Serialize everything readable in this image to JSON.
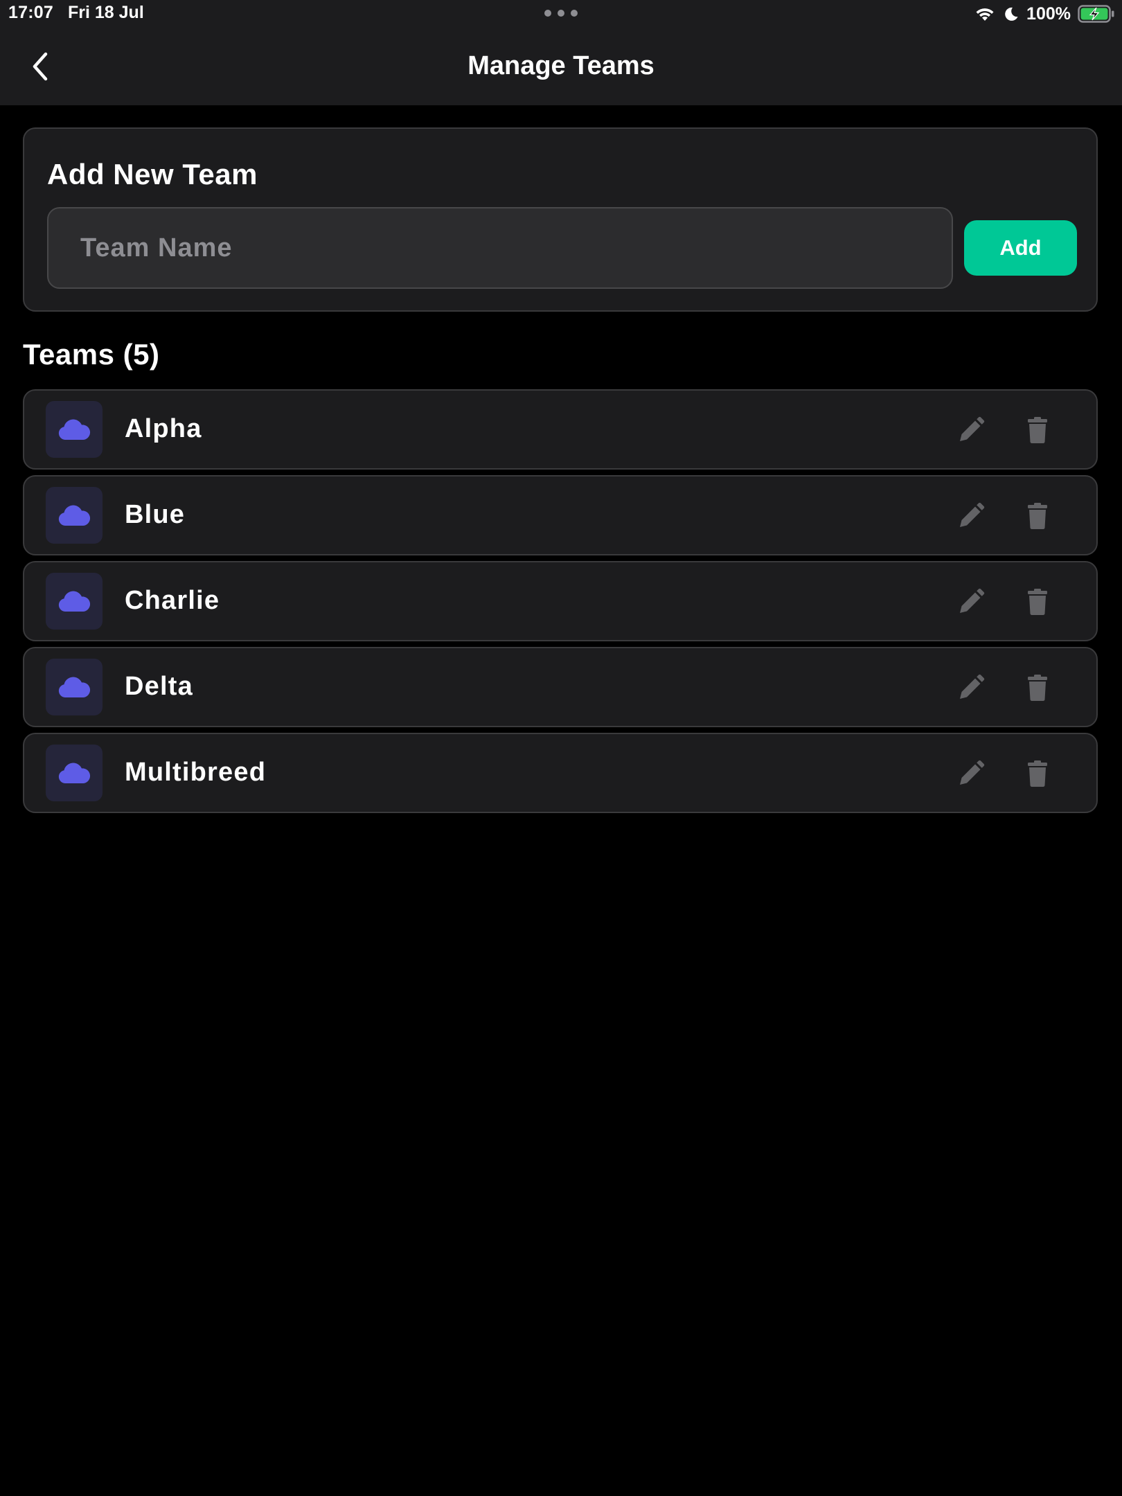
{
  "status_bar": {
    "time": "17:07",
    "date": "Fri 18 Jul",
    "battery_percent": "100%",
    "icons": [
      "wifi-icon",
      "do-not-disturb-moon-icon",
      "battery-charging-icon",
      "multitasking-dots-icon"
    ]
  },
  "nav": {
    "title": "Manage Teams",
    "back_icon": "chevron-left-icon"
  },
  "add_team": {
    "title": "Add New Team",
    "input_placeholder": "Team Name",
    "input_value": "",
    "add_label": "Add"
  },
  "teams_section": {
    "title": "Teams (5)"
  },
  "teams": [
    {
      "name": "Alpha",
      "icon": "cloud-icon"
    },
    {
      "name": "Blue",
      "icon": "cloud-icon"
    },
    {
      "name": "Charlie",
      "icon": "cloud-icon"
    },
    {
      "name": "Delta",
      "icon": "cloud-icon"
    },
    {
      "name": "Multibreed",
      "icon": "cloud-icon"
    }
  ],
  "colors": {
    "background": "#000000",
    "surface": "#1c1c1e",
    "border": "#3a3a3c",
    "accent": "#00c896",
    "team_icon": "#5e5ce6",
    "action_icon": "#636366",
    "battery_fill": "#34c759"
  }
}
